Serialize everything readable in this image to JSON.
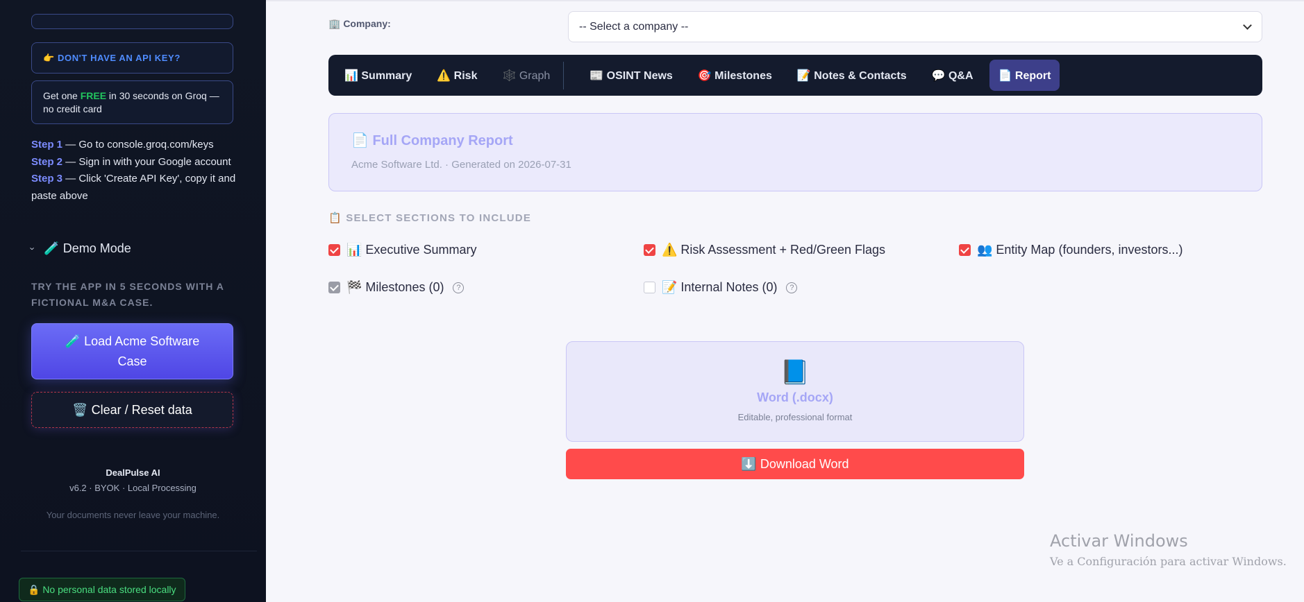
{
  "sidebar": {
    "noapi_label": "👉 DON'T HAVE AN API KEY?",
    "free_pre": "Get one ",
    "free_word": "FREE",
    "free_post": " in 30 seconds on Groq — no credit card",
    "steps": [
      {
        "k": "Step 1",
        "text": " — Go to console.groq.com/keys"
      },
      {
        "k": "Step 2",
        "text": " — Sign in with your Google account"
      },
      {
        "k": "Step 3",
        "text": " — Click 'Create API Key', copy it and paste above"
      }
    ],
    "demo_title": "🧪 Demo Mode",
    "demo_desc": "Try the app in 5 seconds with a fictional M&A case.",
    "load_button": "🧪 Load Acme Software Case",
    "reset_button": "🗑️ Clear / Reset data",
    "brand_name": "DealPulse AI",
    "brand_version": "v6.2 · BYOK · Local Processing",
    "privacy_note": "Your documents never leave your machine.",
    "privacy_badge": "🔒 No personal data stored locally"
  },
  "header": {
    "company_label": "🏢 Company:",
    "company_select_value": "-- Select a company --"
  },
  "tabs": [
    {
      "label": "📊 Summary"
    },
    {
      "label": "⚠️ Risk"
    },
    {
      "label": "🕸️ Graph"
    },
    {
      "label": "📰 OSINT News"
    },
    {
      "label": "🎯 Milestones"
    },
    {
      "label": "📝 Notes & Contacts"
    },
    {
      "label": "💬 Q&A"
    },
    {
      "label": "📄 Report"
    }
  ],
  "report": {
    "title": "📄 Full Company Report",
    "subtitle": "Acme Software Ltd. · Generated on 2026-07-31"
  },
  "sections": {
    "heading": "📋 SELECT SECTIONS TO INCLUDE",
    "items": [
      {
        "label": "📊 Executive Summary",
        "checked": true
      },
      {
        "label": "⚠️ Risk Assessment + Red/Green Flags",
        "checked": true
      },
      {
        "label": "👥 Entity Map (founders, investors...)",
        "checked": true
      },
      {
        "label": "🏁 Milestones (0)",
        "checked": true,
        "disabled": true
      },
      {
        "label": "📝 Internal Notes (0)",
        "checked": false
      }
    ],
    "help_glyph": "?"
  },
  "export": {
    "icon": "📘",
    "format_title": "Word (.docx)",
    "format_desc": "Editable, professional format",
    "download_button": "⬇️ Download Word"
  },
  "watermark": {
    "line1": "Activar Windows",
    "line2": "Ve a Configuración para activar Windows."
  },
  "colors": {
    "accent": "#6366f1",
    "danger": "#ff4b4b",
    "sidebar_bg": "#101624",
    "tab_active": "#3d3f8a",
    "free_green": "#22c55e"
  }
}
